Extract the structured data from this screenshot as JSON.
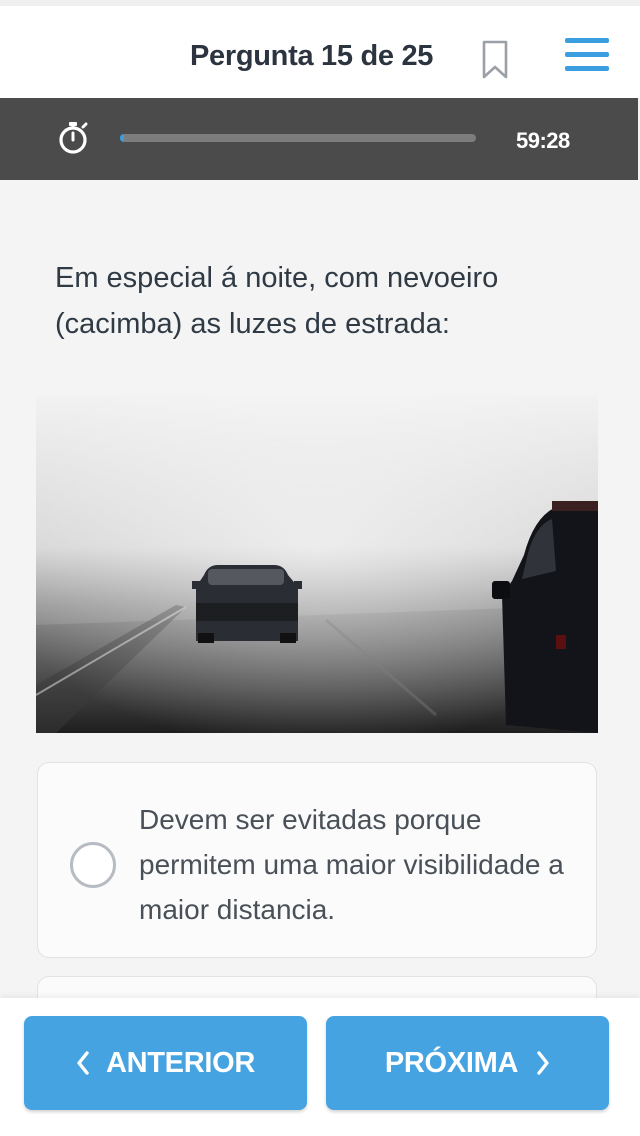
{
  "header": {
    "title": "Pergunta 15 de 25",
    "bookmark_icon": "bookmark-icon",
    "menu_icon": "hamburger-menu-icon"
  },
  "timer": {
    "icon": "stopwatch-icon",
    "remaining": "59:28",
    "progress_fraction": 0.01
  },
  "question": {
    "text": "Em especial á noite, com nevoeiro (cacimba) as luzes de estrada:",
    "image": "foggy-road-with-cars"
  },
  "answers": [
    {
      "text": "Devem ser evitadas porque permitem uma maior visibilidade a maior distancia.",
      "selected": false
    },
    {
      "text": "",
      "selected": false
    }
  ],
  "footer": {
    "prev_label": "ANTERIOR",
    "next_label": "PRÓXIMA"
  },
  "colors": {
    "accent": "#45a3e2",
    "timer_bar": "#4b4b4b",
    "background": "#f4f4f4"
  }
}
